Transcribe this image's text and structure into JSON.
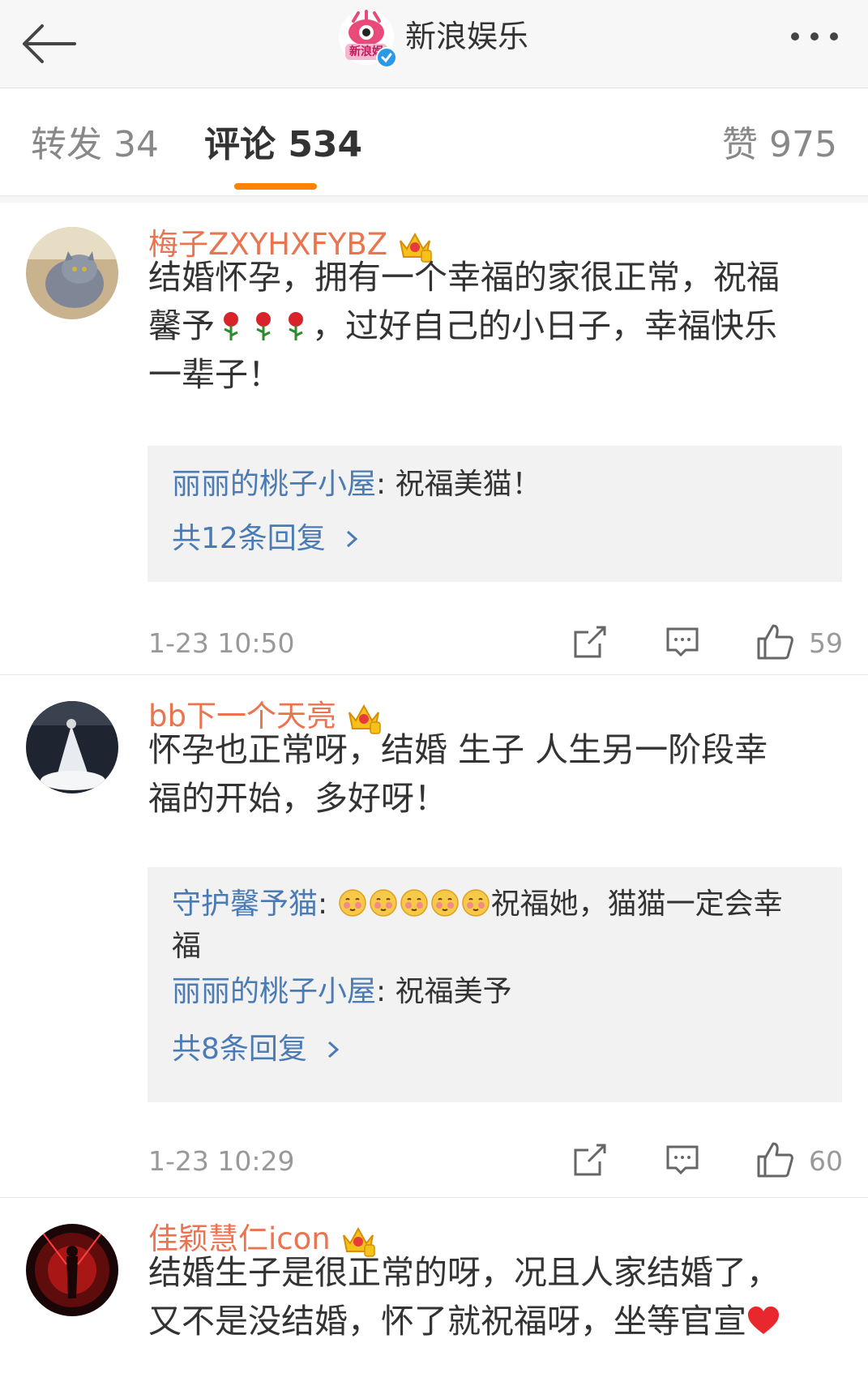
{
  "header": {
    "title": "新浪娱乐",
    "logo_text": "新浪娱"
  },
  "tabs": {
    "repost": "转发 34",
    "comments": "评论 534",
    "likes": "赞 975"
  },
  "comments": [
    {
      "username": "梅子ZXYHXFYBZ",
      "text_a": "结婚怀孕，拥有一个幸福的家很正常，祝福",
      "text_b1": "馨予",
      "text_b2": "，过好自己的小日子，幸福快乐",
      "text_c": "一辈子！",
      "replies": [
        {
          "user": "丽丽的桃子小屋",
          "text": ": 祝福美猫！"
        }
      ],
      "more_replies": "共12条回复",
      "timestamp": "1-23 10:50",
      "likes": "59"
    },
    {
      "username": "bb下一个天亮",
      "text_a": "怀孕也正常呀，结婚 生子 人生另一阶段幸",
      "text_b": "福的开始，多好呀！",
      "replies": [
        {
          "user": "守护馨予猫",
          "text_a": ": ",
          "text_b": "祝福她，猫猫一定会幸",
          "text_c": "福"
        },
        {
          "user": "丽丽的桃子小屋",
          "text": ": 祝福美予"
        }
      ],
      "more_replies": "共8条回复",
      "timestamp": "1-23 10:29",
      "likes": "60"
    },
    {
      "username": "佳颖慧仁icon",
      "text_a": "结婚生子是很正常的呀，况且人家结婚了，",
      "text_b": "又不是没结婚，怀了就祝福呀，坐等官宣"
    }
  ],
  "colors": {
    "accent": "#ff8200",
    "username": "#eb7350",
    "link": "#4a7bb5"
  },
  "icons": [
    "back-arrow-icon",
    "more-icon",
    "crown-icon",
    "rose-icon",
    "share-icon",
    "comment-icon",
    "thumbs-up-icon",
    "heart-icon",
    "blushing-face-icon"
  ]
}
